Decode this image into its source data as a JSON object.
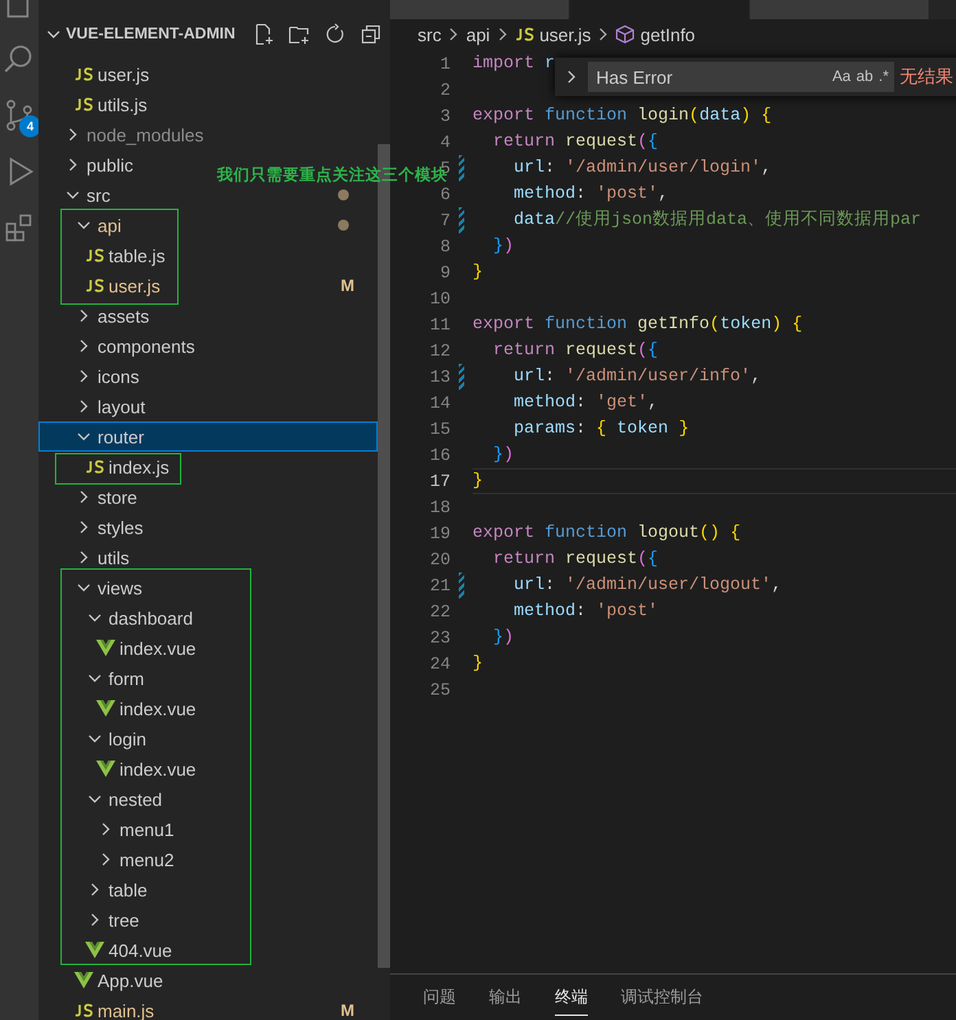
{
  "activity_bar": {
    "badge": "4"
  },
  "explorer": {
    "title": "VUE-ELEMENT-ADMIN",
    "continued": [
      {
        "name": "user.js",
        "kind": "js",
        "selected": false,
        "modified": false,
        "ignored": false
      },
      {
        "name": "utils.js",
        "kind": "js",
        "selected": false,
        "modified": false,
        "ignored": false
      }
    ],
    "items": [
      {
        "name": "node_modules",
        "kind": "folder",
        "expanded": false,
        "selected": false,
        "modified": false,
        "ignored": true
      },
      {
        "name": "public",
        "kind": "folder",
        "expanded": false,
        "selected": false,
        "modified": false,
        "ignored": false
      },
      {
        "name": "src",
        "kind": "folder",
        "expanded": true,
        "selected": false,
        "modified": false,
        "ignored": false,
        "dot": true,
        "children": [
          {
            "name": "api",
            "kind": "folder",
            "expanded": true,
            "selected": false,
            "modified": true,
            "ignored": false,
            "dot": true,
            "children": [
              {
                "name": "table.js",
                "kind": "js",
                "selected": false,
                "modified": false,
                "ignored": false
              },
              {
                "name": "user.js",
                "kind": "js",
                "selected": false,
                "modified": true,
                "ignored": false,
                "badge": "M"
              }
            ]
          },
          {
            "name": "assets",
            "kind": "folder",
            "expanded": false,
            "selected": false,
            "modified": false,
            "ignored": false
          },
          {
            "name": "components",
            "kind": "folder",
            "expanded": false,
            "selected": false,
            "modified": false,
            "ignored": false
          },
          {
            "name": "icons",
            "kind": "folder",
            "expanded": false,
            "selected": false,
            "modified": false,
            "ignored": false
          },
          {
            "name": "layout",
            "kind": "folder",
            "expanded": false,
            "selected": false,
            "modified": false,
            "ignored": false
          },
          {
            "name": "router",
            "kind": "folder",
            "expanded": true,
            "selected": true,
            "modified": false,
            "ignored": false,
            "children": [
              {
                "name": "index.js",
                "kind": "js",
                "selected": false,
                "modified": false,
                "ignored": false
              }
            ]
          },
          {
            "name": "store",
            "kind": "folder",
            "expanded": false,
            "selected": false,
            "modified": false,
            "ignored": false
          },
          {
            "name": "styles",
            "kind": "folder",
            "expanded": false,
            "selected": false,
            "modified": false,
            "ignored": false
          },
          {
            "name": "utils",
            "kind": "folder",
            "expanded": false,
            "selected": false,
            "modified": false,
            "ignored": false
          },
          {
            "name": "views",
            "kind": "folder",
            "expanded": true,
            "selected": false,
            "modified": false,
            "ignored": false,
            "children": [
              {
                "name": "dashboard",
                "kind": "folder",
                "expanded": true,
                "selected": false,
                "modified": false,
                "ignored": false,
                "children": [
                  {
                    "name": "index.vue",
                    "kind": "vue",
                    "selected": false,
                    "modified": false,
                    "ignored": false
                  }
                ]
              },
              {
                "name": "form",
                "kind": "folder",
                "expanded": true,
                "selected": false,
                "modified": false,
                "ignored": false,
                "children": [
                  {
                    "name": "index.vue",
                    "kind": "vue",
                    "selected": false,
                    "modified": false,
                    "ignored": false
                  }
                ]
              },
              {
                "name": "login",
                "kind": "folder",
                "expanded": true,
                "selected": false,
                "modified": false,
                "ignored": false,
                "children": [
                  {
                    "name": "index.vue",
                    "kind": "vue",
                    "selected": false,
                    "modified": false,
                    "ignored": false
                  }
                ]
              },
              {
                "name": "nested",
                "kind": "folder",
                "expanded": true,
                "selected": false,
                "modified": false,
                "ignored": false,
                "children": [
                  {
                    "name": "menu1",
                    "kind": "folder",
                    "expanded": false,
                    "selected": false,
                    "modified": false,
                    "ignored": false
                  },
                  {
                    "name": "menu2",
                    "kind": "folder",
                    "expanded": false,
                    "selected": false,
                    "modified": false,
                    "ignored": false
                  }
                ]
              },
              {
                "name": "table",
                "kind": "folder",
                "expanded": false,
                "selected": false,
                "modified": false,
                "ignored": false
              },
              {
                "name": "tree",
                "kind": "folder",
                "expanded": false,
                "selected": false,
                "modified": false,
                "ignored": false
              },
              {
                "name": "404.vue",
                "kind": "vue",
                "selected": false,
                "modified": false,
                "ignored": false
              }
            ]
          },
          {
            "name": "App.vue",
            "kind": "vue",
            "selected": false,
            "modified": false,
            "ignored": false
          },
          {
            "name": "main.js",
            "kind": "js",
            "selected": false,
            "modified": true,
            "ignored": false,
            "badge": "M"
          }
        ]
      }
    ]
  },
  "annotation": {
    "text": "我们只需要重点关注这三个模块"
  },
  "editor_tabs": [
    {
      "selected": false
    },
    {
      "selected": true
    },
    {
      "selected": false
    }
  ],
  "breadcrumb": [
    "src",
    "api",
    "user.js",
    "getInfo"
  ],
  "find_widget": {
    "value": "Has Error",
    "options": [
      "Aa",
      "ab",
      ".*"
    ],
    "result": "无结果"
  },
  "code_lines": [
    {
      "number": "1",
      "changed": false,
      "current": false,
      "tokens": [
        {
          "t": "import",
          "kind": "kw"
        },
        {
          "t": " r",
          "kind": "var"
        }
      ]
    },
    {
      "number": "2",
      "changed": false,
      "current": false
    },
    {
      "number": "3",
      "changed": false,
      "current": false,
      "tokens": [
        {
          "t": "export",
          "kind": "kw"
        },
        {
          "t": " function ",
          "kind": "decl"
        },
        {
          "t": "login",
          "kind": "func"
        },
        {
          "t": "(",
          "kind": "b1"
        },
        {
          "t": "data",
          "kind": "var"
        },
        {
          "t": ")",
          "kind": "b1"
        },
        {
          "t": " {",
          "kind": "b1"
        }
      ]
    },
    {
      "number": "4",
      "changed": false,
      "current": false,
      "tokens": [
        {
          "t": "  return ",
          "kind": "kw"
        },
        {
          "t": "request",
          "kind": "func"
        },
        {
          "t": "(",
          "kind": "b2"
        },
        {
          "t": "{",
          "kind": "b3"
        }
      ]
    },
    {
      "number": "5",
      "changed": true,
      "current": false,
      "tokens": [
        {
          "t": "    url",
          "kind": "var"
        },
        {
          "t": ": ",
          "kind": "punc"
        },
        {
          "t": "'/admin/user/login'",
          "kind": "str"
        },
        {
          "t": ",",
          "kind": "punc"
        }
      ]
    },
    {
      "number": "6",
      "changed": false,
      "current": false,
      "tokens": [
        {
          "t": "    method",
          "kind": "var"
        },
        {
          "t": ": ",
          "kind": "punc"
        },
        {
          "t": "'post'",
          "kind": "str"
        },
        {
          "t": ",",
          "kind": "punc"
        }
      ]
    },
    {
      "number": "7",
      "changed": true,
      "current": false,
      "tokens": [
        {
          "t": "    data",
          "kind": "var"
        },
        {
          "t": "//使用json数据用data、使用不同数据用par",
          "kind": "comment"
        }
      ]
    },
    {
      "number": "8",
      "changed": false,
      "current": false,
      "tokens": [
        {
          "t": "  }",
          "kind": "b3"
        },
        {
          "t": ")",
          "kind": "b2"
        }
      ]
    },
    {
      "number": "9",
      "changed": false,
      "current": false,
      "tokens": [
        {
          "t": "}",
          "kind": "b1"
        }
      ]
    },
    {
      "number": "10",
      "changed": false,
      "current": false
    },
    {
      "number": "11",
      "changed": false,
      "current": false,
      "tokens": [
        {
          "t": "export",
          "kind": "kw"
        },
        {
          "t": " function ",
          "kind": "decl"
        },
        {
          "t": "getInfo",
          "kind": "func"
        },
        {
          "t": "(",
          "kind": "b1"
        },
        {
          "t": "token",
          "kind": "var"
        },
        {
          "t": ")",
          "kind": "b1"
        },
        {
          "t": " {",
          "kind": "b1"
        }
      ]
    },
    {
      "number": "12",
      "changed": false,
      "current": false,
      "tokens": [
        {
          "t": "  return ",
          "kind": "kw"
        },
        {
          "t": "request",
          "kind": "func"
        },
        {
          "t": "(",
          "kind": "b2"
        },
        {
          "t": "{",
          "kind": "b3"
        }
      ]
    },
    {
      "number": "13",
      "changed": true,
      "current": false,
      "tokens": [
        {
          "t": "    url",
          "kind": "var"
        },
        {
          "t": ": ",
          "kind": "punc"
        },
        {
          "t": "'/admin/user/info'",
          "kind": "str"
        },
        {
          "t": ",",
          "kind": "punc"
        }
      ]
    },
    {
      "number": "14",
      "changed": false,
      "current": false,
      "tokens": [
        {
          "t": "    method",
          "kind": "var"
        },
        {
          "t": ": ",
          "kind": "punc"
        },
        {
          "t": "'get'",
          "kind": "str"
        },
        {
          "t": ",",
          "kind": "punc"
        }
      ]
    },
    {
      "number": "15",
      "changed": false,
      "current": false,
      "tokens": [
        {
          "t": "    params",
          "kind": "var"
        },
        {
          "t": ": ",
          "kind": "punc"
        },
        {
          "t": "{",
          "kind": "b1"
        },
        {
          "t": " token ",
          "kind": "var"
        },
        {
          "t": "}",
          "kind": "b1"
        }
      ]
    },
    {
      "number": "16",
      "changed": false,
      "current": false,
      "tokens": [
        {
          "t": "  }",
          "kind": "b3"
        },
        {
          "t": ")",
          "kind": "b2"
        }
      ]
    },
    {
      "number": "17",
      "changed": false,
      "current": true,
      "tokens": [
        {
          "t": "}",
          "kind": "b1"
        }
      ]
    },
    {
      "number": "18",
      "changed": false,
      "current": false
    },
    {
      "number": "19",
      "changed": false,
      "current": false,
      "tokens": [
        {
          "t": "export",
          "kind": "kw"
        },
        {
          "t": " function ",
          "kind": "decl"
        },
        {
          "t": "logout",
          "kind": "func"
        },
        {
          "t": "()",
          "kind": "b1"
        },
        {
          "t": " {",
          "kind": "b1"
        }
      ]
    },
    {
      "number": "20",
      "changed": false,
      "current": false,
      "tokens": [
        {
          "t": "  return ",
          "kind": "kw"
        },
        {
          "t": "request",
          "kind": "func"
        },
        {
          "t": "(",
          "kind": "b2"
        },
        {
          "t": "{",
          "kind": "b3"
        }
      ]
    },
    {
      "number": "21",
      "changed": true,
      "current": false,
      "tokens": [
        {
          "t": "    url",
          "kind": "var"
        },
        {
          "t": ": ",
          "kind": "punc"
        },
        {
          "t": "'/admin/user/logout'",
          "kind": "str"
        },
        {
          "t": ",",
          "kind": "punc"
        }
      ]
    },
    {
      "number": "22",
      "changed": false,
      "current": false,
      "tokens": [
        {
          "t": "    method",
          "kind": "var"
        },
        {
          "t": ": ",
          "kind": "punc"
        },
        {
          "t": "'post'",
          "kind": "str"
        }
      ]
    },
    {
      "number": "23",
      "changed": false,
      "current": false,
      "tokens": [
        {
          "t": "  }",
          "kind": "b3"
        },
        {
          "t": ")",
          "kind": "b2"
        }
      ]
    },
    {
      "number": "24",
      "changed": false,
      "current": false,
      "tokens": [
        {
          "t": "}",
          "kind": "b1"
        }
      ]
    },
    {
      "number": "25",
      "changed": false,
      "current": false
    }
  ],
  "panel_tabs": [
    {
      "label": "问题",
      "selected": false
    },
    {
      "label": "输出",
      "selected": false
    },
    {
      "label": "终端",
      "selected": true
    },
    {
      "label": "调试控制台",
      "selected": false
    }
  ]
}
